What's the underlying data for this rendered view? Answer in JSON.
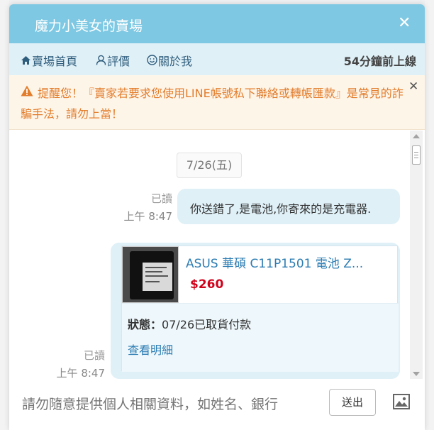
{
  "window": {
    "title": "魔力小美女的賣場",
    "close_glyph": "✕"
  },
  "nav": {
    "items": [
      {
        "label": "賣場首頁",
        "icon": "home-icon"
      },
      {
        "label": "評價",
        "icon": "user-icon"
      },
      {
        "label": "關於我",
        "icon": "smile-icon"
      }
    ],
    "last_online": "54分鐘前上線"
  },
  "warning": {
    "text": "提醒您！『賣家若要求您使用LINE帳號私下聯絡或轉帳匯款』是常見的詐騙手法，請勿上當！",
    "icon": "warning-icon",
    "close_glyph": "✕",
    "color": "#e27d2c"
  },
  "chat": {
    "date": "7/26(五)",
    "messages": [
      {
        "read": "已讀",
        "time": "上午 8:47",
        "text": "你送錯了,是電池,你寄來的是充電器."
      },
      {
        "read": "已讀",
        "time": "上午 8:47",
        "product": {
          "name": "ASUS 華碩 C11P1501 電池 Z...",
          "price": "$260",
          "status_label": "狀態：",
          "status_value": "07/26已取貨付款",
          "detail_link": "查看明細"
        }
      }
    ]
  },
  "composer": {
    "placeholder": "請勿隨意提供個人相關資料，如姓名、銀行",
    "send_label": "送出",
    "image_icon": "image-icon"
  },
  "colors": {
    "titlebar": "#7ec8e3",
    "navbar": "#dff0f7",
    "bubble": "#dff0f7",
    "link": "#2d7db3",
    "price": "#d0021b"
  }
}
